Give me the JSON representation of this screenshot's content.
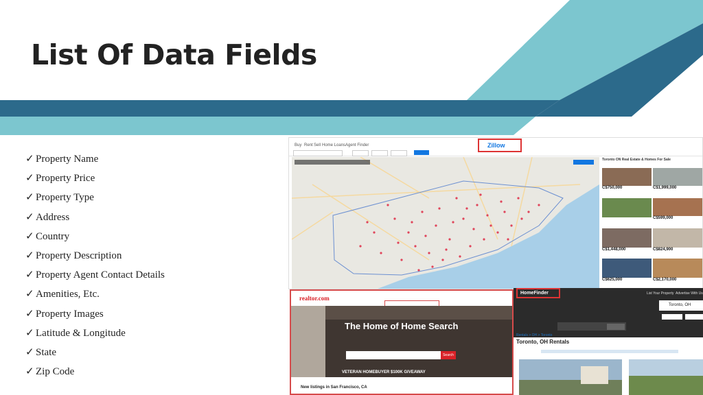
{
  "slide": {
    "title": "List Of Data Fields",
    "accent_colors": {
      "dark_blue": "#2c6a8b",
      "light_teal": "#7cc6cf",
      "title_text": "#222222"
    }
  },
  "fields": [
    "Property Name",
    "Property Price",
    "Property Type",
    "Address",
    "Country",
    "Property Description",
    "Property Agent Contact Details",
    "Amenities, Etc.",
    "Property Images",
    "Latitude & Longitude",
    "State",
    "Zip Code"
  ],
  "check_glyph": "✓",
  "zillow": {
    "logo": "Zillow",
    "nav": [
      "Buy",
      "Rent",
      "Sell",
      "Home Loans",
      "Agent Finder"
    ],
    "listing_header": "Toronto ON Real Estate & Homes For Sale",
    "prices": [
      "C$750,000",
      "C$1,999,000",
      "C$599,000",
      "C$1,448,000",
      "C$824,900",
      "C$625,000",
      "C$2,170,000"
    ]
  },
  "realtor": {
    "logo": "realtor.com",
    "headline": "The Home of Home Search",
    "search_button": "Search",
    "banner": "VETERAN HOMEBUYER $100K GIVEAWAY",
    "listings_heading": "New listings in San Francisco, CA"
  },
  "homefinder": {
    "logo": "HomeFinder",
    "nav": [
      "List Your Property",
      "Advertise With Us"
    ],
    "search_value": "Toronto, OH",
    "breadcrumb": "Rentals > OH > Toronto",
    "heading": "Toronto, OH Rentals"
  }
}
